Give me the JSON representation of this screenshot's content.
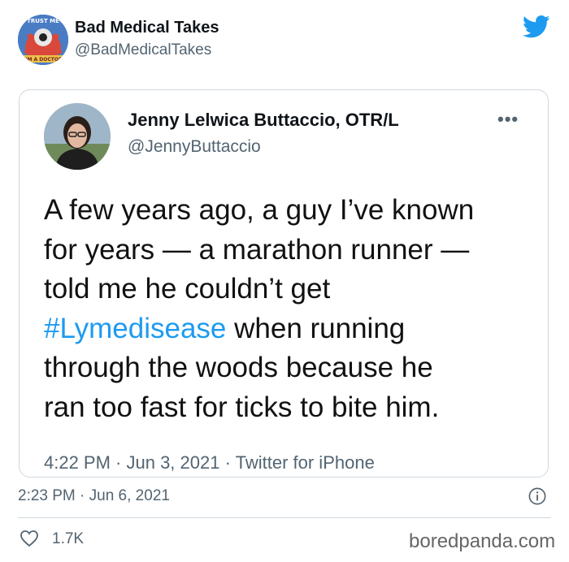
{
  "tweet": {
    "author_name": "Bad Medical Takes",
    "author_handle": "@BadMedicalTakes",
    "avatar_text_top": "TRUST ME",
    "avatar_text_bottom": "I'M A DOCTOR",
    "timestamp": "2:23 PM · Jun 6, 2021",
    "likes": "1.7K"
  },
  "quoted": {
    "author_name": "Jenny Lelwica Buttaccio, OTR/L",
    "author_handle": "@JennyButtaccio",
    "lines": {
      "l1": "A few years ago, a guy I’ve known",
      "l2": "for years — a marathon runner —",
      "l3": "told me he couldn’t get",
      "l4_hashtag": "#Lymedisease",
      "l4_rest": " when running",
      "l5": "through the woods because he",
      "l6": "ran too fast for ticks to bite him."
    },
    "meta": "4:22 PM · Jun 3, 2021 · Twitter for iPhone"
  },
  "watermark": "boredpanda.com",
  "colors": {
    "accent": "#1d9bf0",
    "muted": "#536471"
  },
  "icons": [
    "twitter-bird-icon",
    "more-icon",
    "info-icon",
    "heart-icon"
  ]
}
